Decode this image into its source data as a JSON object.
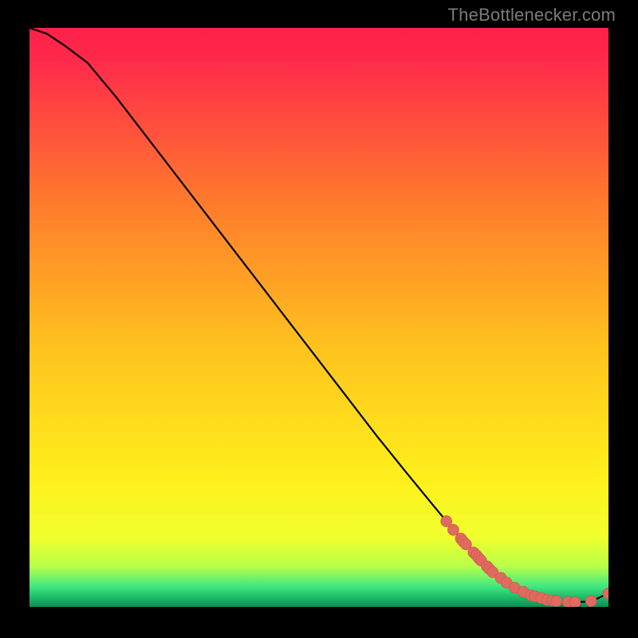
{
  "credit": "TheBottlenecker.com",
  "colors": {
    "gradient_top": "#ff1f4a",
    "gradient_mid": "#ffd400",
    "gradient_bottom_yellow": "#f6ff1f",
    "gradient_green": "#22e07b",
    "gradient_dark_green": "#0d8a4d",
    "line": "#000000",
    "point_fill": "#e06a60",
    "point_stroke": "#c9544b"
  },
  "chart_data": {
    "type": "line",
    "title": "",
    "xlabel": "",
    "ylabel": "",
    "xlim": [
      0,
      100
    ],
    "ylim": [
      0,
      100
    ],
    "series": [
      {
        "name": "curve",
        "x": [
          0,
          3,
          6,
          10,
          15,
          20,
          25,
          30,
          35,
          40,
          45,
          50,
          55,
          60,
          65,
          70,
          74,
          78,
          82,
          85,
          88,
          90,
          92,
          94,
          96,
          98,
          100
        ],
        "y": [
          100,
          99,
          97,
          94,
          88,
          81.5,
          75,
          68.5,
          62,
          55.5,
          49,
          42.5,
          36,
          29.5,
          23.3,
          17.2,
          12.4,
          8.1,
          4.7,
          2.8,
          1.6,
          1.1,
          0.9,
          0.8,
          0.9,
          1.4,
          2.4
        ]
      }
    ],
    "points": [
      {
        "x": 72.0,
        "y": 14.8
      },
      {
        "x": 73.2,
        "y": 13.3
      },
      {
        "x": 74.5,
        "y": 11.8
      },
      {
        "x": 74.9,
        "y": 11.3
      },
      {
        "x": 75.4,
        "y": 10.8
      },
      {
        "x": 76.7,
        "y": 9.4
      },
      {
        "x": 77.2,
        "y": 8.9
      },
      {
        "x": 77.6,
        "y": 8.4
      },
      {
        "x": 78.0,
        "y": 8.0
      },
      {
        "x": 79.0,
        "y": 7.0
      },
      {
        "x": 79.4,
        "y": 6.6
      },
      {
        "x": 80.0,
        "y": 6.0
      },
      {
        "x": 81.4,
        "y": 5.0
      },
      {
        "x": 82.4,
        "y": 4.2
      },
      {
        "x": 83.8,
        "y": 3.3
      },
      {
        "x": 85.3,
        "y": 2.6
      },
      {
        "x": 86.6,
        "y": 2.0
      },
      {
        "x": 87.3,
        "y": 1.8
      },
      {
        "x": 88.4,
        "y": 1.5
      },
      {
        "x": 89.4,
        "y": 1.2
      },
      {
        "x": 90.3,
        "y": 1.1
      },
      {
        "x": 91.0,
        "y": 1.0
      },
      {
        "x": 93.0,
        "y": 0.85
      },
      {
        "x": 94.2,
        "y": 0.8
      },
      {
        "x": 97.0,
        "y": 1.0
      },
      {
        "x": 100.0,
        "y": 2.3
      }
    ]
  }
}
